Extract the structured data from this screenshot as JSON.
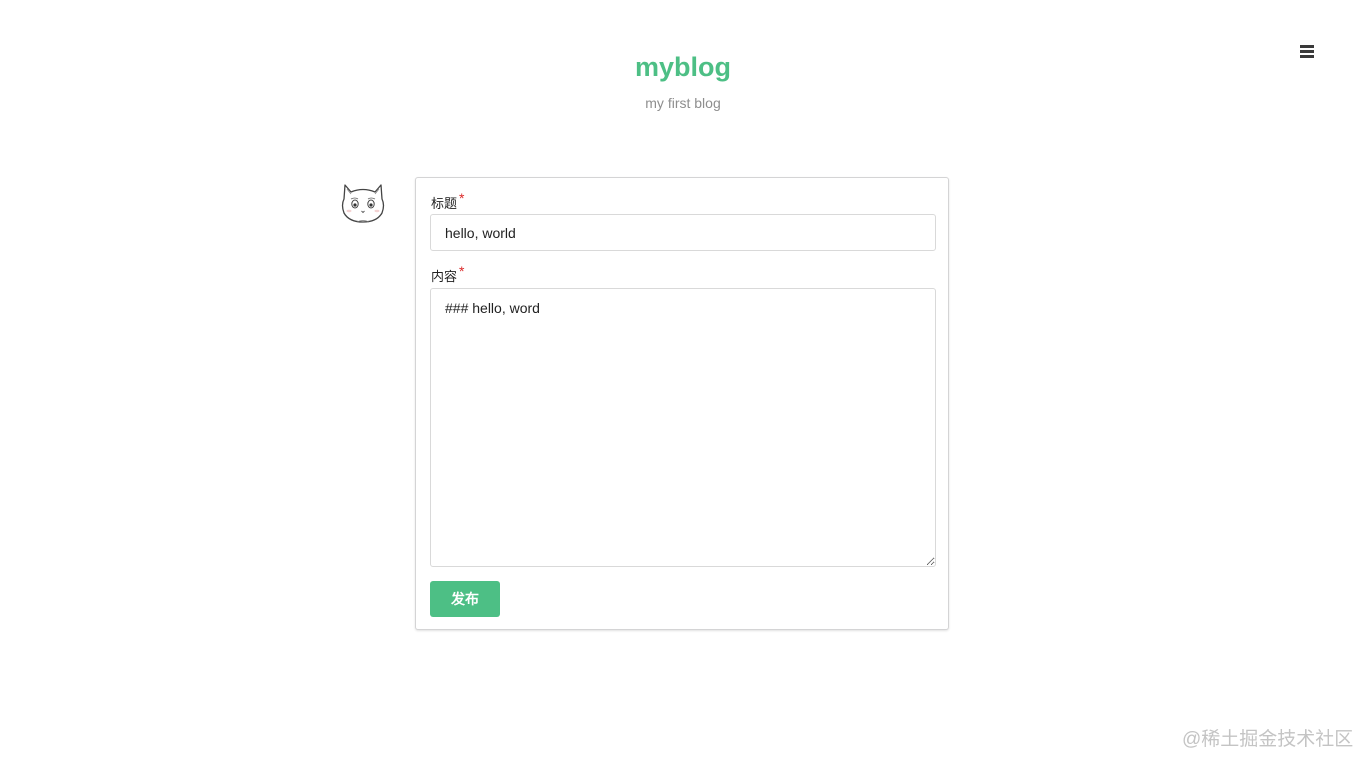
{
  "header": {
    "title": "myblog",
    "subtitle": "my first blog",
    "menu_icon": "hamburger-menu-icon"
  },
  "avatar": {
    "icon": "cat-avatar-icon"
  },
  "form": {
    "title_label": "标题",
    "title_required_mark": "*",
    "title_value": "hello, world",
    "content_label": "内容",
    "content_required_mark": "*",
    "content_value": "### hello, word",
    "submit_label": "发布"
  },
  "watermark": "@稀土掘金技术社区",
  "colors": {
    "accent": "#4dbf85",
    "required": "#db2828",
    "subtitle": "#8e8e8e",
    "border": "#d4d4d5"
  }
}
